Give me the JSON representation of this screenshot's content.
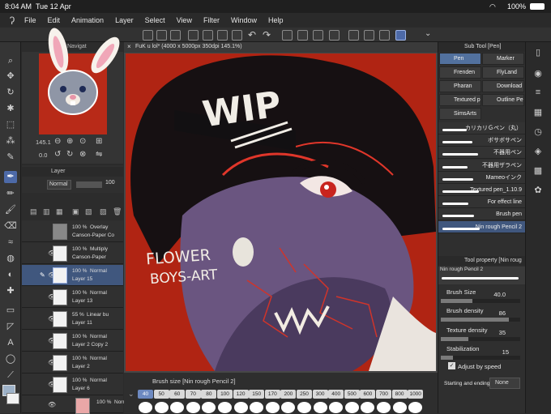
{
  "status": {
    "time": "8:04 AM",
    "date": "Tue 12 Apr",
    "battery": "100%"
  },
  "menu": [
    "File",
    "Edit",
    "Animation",
    "Layer",
    "Select",
    "View",
    "Filter",
    "Window",
    "Help"
  ],
  "navigator": {
    "tab": "Navigat",
    "zoom": "145.1",
    "angle": "0.0"
  },
  "layer_panel": {
    "tab": "Layer",
    "blend": "Normal",
    "opacity": "100"
  },
  "layers": [
    {
      "opacity": "100 %",
      "mode": "Overlay",
      "name": "Canson-Paper Co"
    },
    {
      "opacity": "100 %",
      "mode": "Multiply",
      "name": "Canson-Paper"
    },
    {
      "opacity": "100 %",
      "mode": "Normal",
      "name": "Layer 15"
    },
    {
      "opacity": "100 %",
      "mode": "Normal",
      "name": "Layer 13"
    },
    {
      "opacity": "55 %",
      "mode": "Linear bu",
      "name": "Layer 11"
    },
    {
      "opacity": "100 %",
      "mode": "Normal",
      "name": "Layer 2 Copy 2"
    },
    {
      "opacity": "100 %",
      "mode": "Normal",
      "name": "Layer 2"
    },
    {
      "opacity": "100 %",
      "mode": "Normal",
      "name": "Layer 6"
    },
    {
      "opacity": "100 %",
      "mode": "Normal",
      "name": ""
    }
  ],
  "document": {
    "tab": "FuK u lol* (4000 x 5000px 350dpi 145.1%)"
  },
  "artwork": {
    "text_wip": "WIP",
    "text_sig_1": "FLOWER",
    "text_sig_2": "BOYS-ART"
  },
  "brush_size_bar": {
    "label": "Brush size [Nin rough Pencil 2]",
    "sizes": [
      "40",
      "50",
      "60",
      "70",
      "80",
      "100",
      "120",
      "150",
      "170",
      "200",
      "250",
      "300",
      "400",
      "500",
      "600",
      "700",
      "800",
      "1000"
    ]
  },
  "subtool_panel": {
    "title": "Sub Tool [Pen]",
    "tools": [
      "Pen",
      "Marker",
      "Frenden",
      "FlyLand",
      "Pharan",
      "Download",
      "Textured p",
      "Outline Pen",
      "SimsArts"
    ]
  },
  "brushes": [
    "カリカリＧペン（丸）",
    "ボサボサペン",
    "不器用ペン",
    "不器用ザラペン",
    "Mameoインク",
    "Textured pen_1.10.9",
    "For effect line",
    "Brush pen",
    "Nin rough Pencil 2"
  ],
  "tool_property": {
    "title": "Tool property [Nin roug",
    "preset": "Nin rough Pencil 2",
    "brush_size_label": "Brush Size",
    "brush_size": "40.0",
    "brush_size_fill": 0.4,
    "brush_density_label": "Brush density",
    "brush_density": "86",
    "brush_density_fill": 0.86,
    "texture_density_label": "Texture density",
    "texture_density": "35",
    "texture_density_fill": 0.35,
    "stabilization_label": "Stabilization",
    "stabilization": "15",
    "stabilization_fill": 0.15,
    "adjust_speed": "Adjust by speed",
    "start_end_label": "Starting and ending",
    "start_end": "None"
  },
  "colors": {
    "accent": "#4d6aa8",
    "canvas_bg": "#b02413"
  }
}
